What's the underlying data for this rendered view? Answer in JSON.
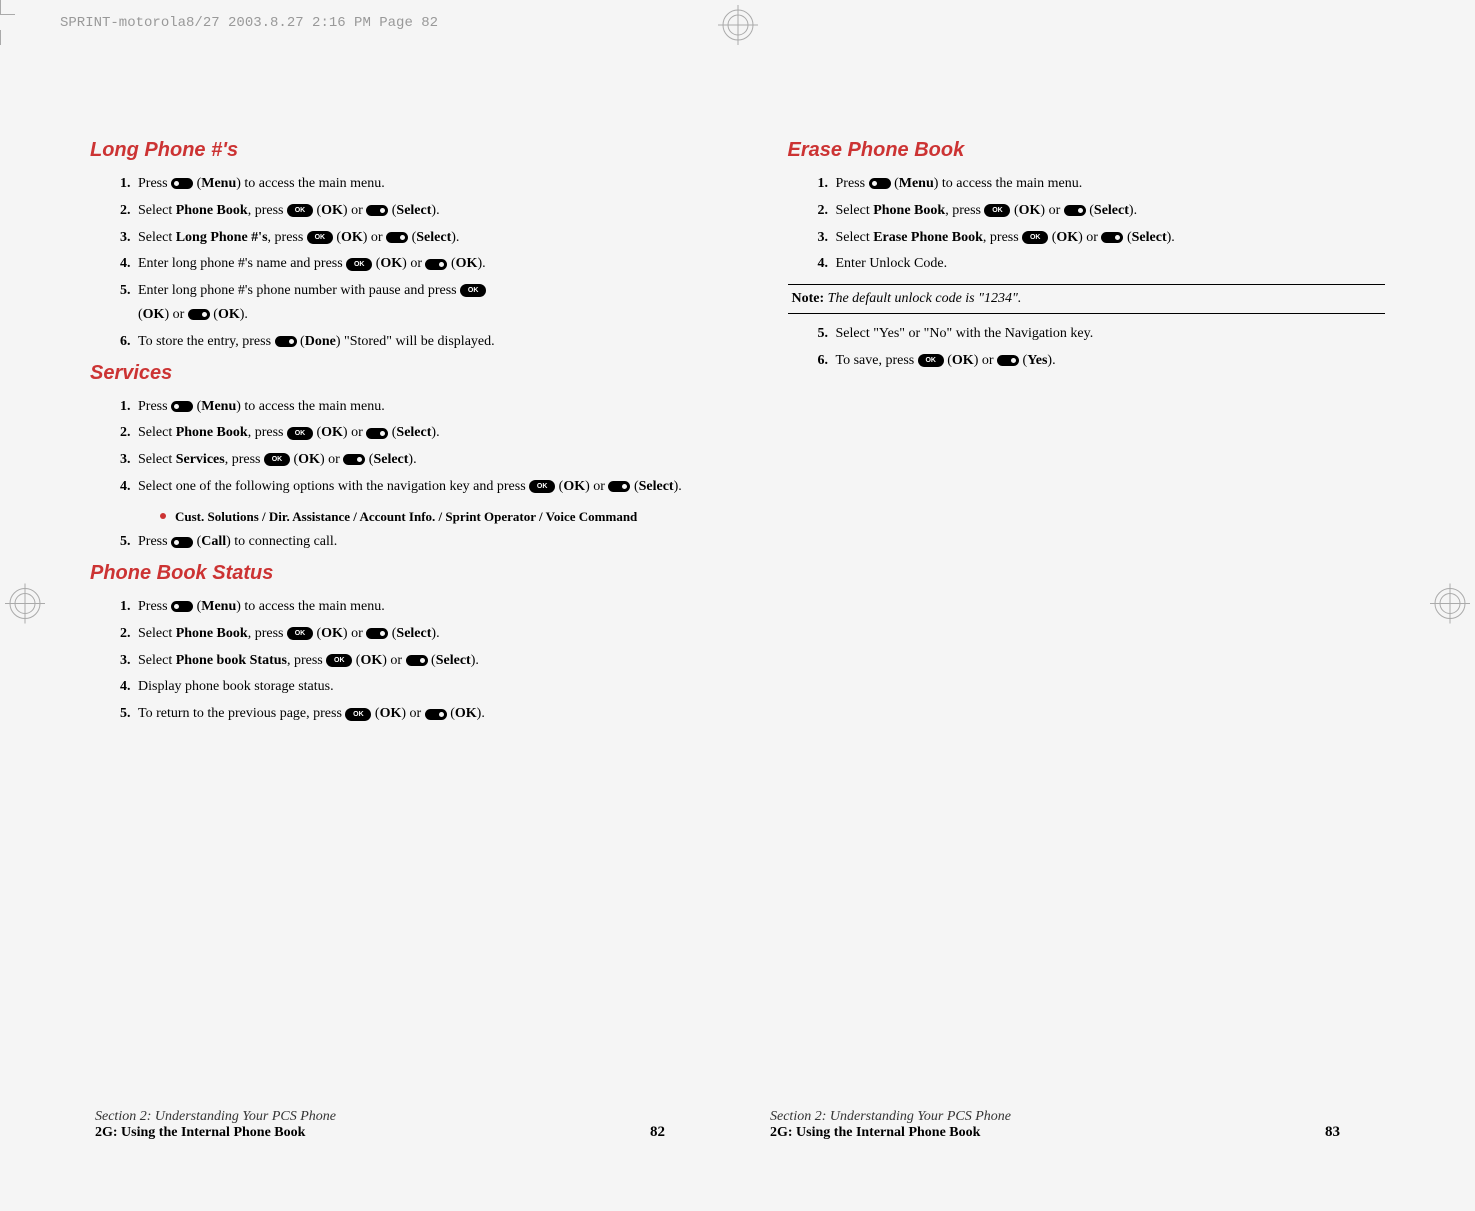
{
  "headerStrip": "SPRINT-motorola8/27  2003.8.27  2:16 PM  Page 82",
  "leftPage": {
    "headings": {
      "longPhone": "Long Phone #'s",
      "services": "Services",
      "pbStatus": "Phone Book Status"
    },
    "longPhoneSteps": [
      {
        "num": "1.",
        "pre": "Press ",
        "icon": "softkey-left",
        "mid": " (",
        "b1": "Menu",
        "post": ") to access the main menu."
      },
      {
        "num": "2.",
        "pre": "Select ",
        "b0": "Phone Book",
        "mid1": ", press ",
        "icon1": "ok",
        "mid2": " (",
        "b1": "OK",
        "mid3": ") or ",
        "icon2": "softkey-right",
        "mid4": " (",
        "b2": "Select",
        "post": ")."
      },
      {
        "num": "3.",
        "pre": "Select ",
        "b0": "Long Phone #'s",
        "mid1": ", press ",
        "icon1": "ok",
        "mid2": " (",
        "b1": "OK",
        "mid3": ") or ",
        "icon2": "softkey-right",
        "mid4": " (",
        "b2": "Select",
        "post": ")."
      },
      {
        "num": "4.",
        "pre": "Enter long phone #'s name and press ",
        "icon1": "ok",
        "mid2": " (",
        "b1": "OK",
        "mid3": ") or ",
        "icon2": "softkey-right",
        "mid4": " (",
        "b2": "OK",
        "post": ")."
      },
      {
        "num": "5.",
        "pre": "Enter long phone #'s phone number with pause and press ",
        "icon1": "ok",
        "line2pre": "(",
        "b1": "OK",
        "mid3": ") or ",
        "icon2": "softkey-right",
        "mid4": " (",
        "b2": "OK",
        "post": ")."
      },
      {
        "num": "6.",
        "pre": "To store the entry, press ",
        "icon": "softkey-right",
        "mid": " (",
        "b1": "Done",
        "post": ") \"Stored\" will be displayed."
      }
    ],
    "servicesSteps": [
      {
        "num": "1.",
        "pre": "Press ",
        "icon": "softkey-left",
        "mid": " (",
        "b1": "Menu",
        "post": ") to access the main menu."
      },
      {
        "num": "2.",
        "pre": "Select ",
        "b0": "Phone Book",
        "mid1": ", press ",
        "icon1": "ok",
        "mid2": " (",
        "b1": "OK",
        "mid3": ") or ",
        "icon2": "softkey-right",
        "mid4": " (",
        "b2": "Select",
        "post": ")."
      },
      {
        "num": "3.",
        "pre": "Select ",
        "b0": "Services",
        "mid1": ", press ",
        "icon1": "ok",
        "mid2": " (",
        "b1": "OK",
        "mid3": ") or ",
        "icon2": "softkey-right",
        "mid4": " (",
        "b2": "Select",
        "post": ")."
      },
      {
        "num": "4.",
        "pre": "Select one of the following options with the navigation key and press ",
        "icon1": "ok",
        "mid2": " (",
        "b1": "OK",
        "mid3": ") or ",
        "icon2": "softkey-right",
        "mid4": " (",
        "b2": "Select",
        "post": ")."
      }
    ],
    "servicesBullet": "Cust. Solutions / Dir. Assistance / Account Info. / Sprint Operator / Voice Command",
    "servicesStep5": {
      "num": "5.",
      "pre": "Press ",
      "icon": "softkey-left",
      "mid": " (",
      "b1": "Call",
      "post": ") to connecting call."
    },
    "pbStatusSteps": [
      {
        "num": "1.",
        "pre": "Press ",
        "icon": "softkey-left",
        "mid": " (",
        "b1": "Menu",
        "post": ") to access the main menu."
      },
      {
        "num": "2.",
        "pre": "Select ",
        "b0": "Phone Book",
        "mid1": ", press ",
        "icon1": "ok",
        "mid2": " (",
        "b1": "OK",
        "mid3": ") or ",
        "icon2": "softkey-right",
        "mid4": " (",
        "b2": "Select",
        "post": ")."
      },
      {
        "num": "3.",
        "pre": "Select ",
        "b0": "Phone book Status",
        "mid1": ", press ",
        "icon1": "ok",
        "mid2": " (",
        "b1": "OK",
        "mid3": ") or ",
        "icon2": "softkey-right",
        "mid4": " (",
        "b2": "Select",
        "post": ")."
      },
      {
        "num": "4.",
        "pre": "Display phone book storage status."
      },
      {
        "num": "5.",
        "pre": "To return to the previous page, press ",
        "icon1": "ok",
        "mid2": " (",
        "b1": "OK",
        "mid3": ") or ",
        "icon2": "softkey-right",
        "mid4": " (",
        "b2": "OK",
        "post": ")."
      }
    ],
    "footer": {
      "section": "Section 2: Understanding Your PCS Phone",
      "title": "2G: Using the Internal Phone Book",
      "page": "82"
    }
  },
  "rightPage": {
    "headings": {
      "erase": "Erase Phone Book"
    },
    "eraseStepsTop": [
      {
        "num": "1.",
        "pre": "Press ",
        "icon": "softkey-left",
        "mid": " (",
        "b1": "Menu",
        "post": ") to access the main menu."
      },
      {
        "num": "2.",
        "pre": "Select ",
        "b0": "Phone Book",
        "mid1": ", press ",
        "icon1": "ok",
        "mid2": " (",
        "b1": "OK",
        "mid3": ") or ",
        "icon2": "softkey-right",
        "mid4": " (",
        "b2": "Select",
        "post": ")."
      },
      {
        "num": "3.",
        "pre": "Select ",
        "b0": "Erase Phone Book",
        "mid1": ", press ",
        "icon1": "ok",
        "mid2": " (",
        "b1": "OK",
        "mid3": ") or ",
        "icon2": "softkey-right",
        "mid4": " (",
        "b2": "Select",
        "post": ")."
      },
      {
        "num": "4.",
        "pre": "Enter Unlock Code."
      }
    ],
    "note": {
      "label": "Note:",
      "text": " The default unlock code is \"1234\"."
    },
    "eraseStepsBottom": [
      {
        "num": "5.",
        "pre": "Select \"Yes\" or \"No\" with the Navigation key."
      },
      {
        "num": "6.",
        "pre": "To save, press ",
        "icon1": "ok",
        "mid2": " (",
        "b1": "OK",
        "mid3": ") or ",
        "icon2": "softkey-right",
        "mid4": " (",
        "b2": "Yes",
        "post": ")."
      }
    ],
    "footer": {
      "section": "Section 2: Understanding Your PCS Phone",
      "title": "2G: Using the Internal Phone Book",
      "page": "83"
    }
  },
  "okLabel": "OK"
}
